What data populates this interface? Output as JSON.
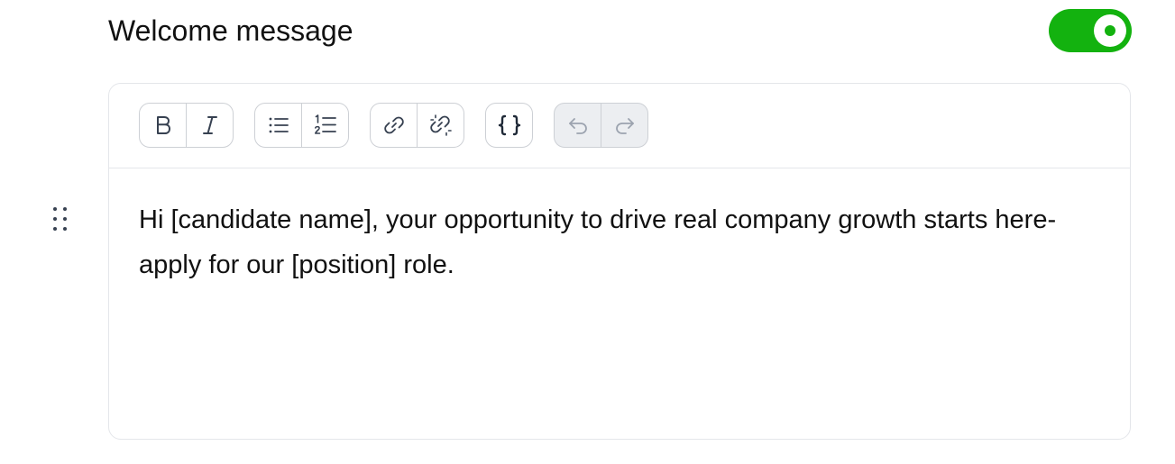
{
  "section": {
    "title": "Welcome message",
    "toggle_on": true
  },
  "toolbar": {
    "groups": [
      {
        "buttons": [
          {
            "name": "bold",
            "icon": "bold-icon"
          },
          {
            "name": "italic",
            "icon": "italic-icon"
          }
        ]
      },
      {
        "buttons": [
          {
            "name": "bullet-list",
            "icon": "bullet-list-icon"
          },
          {
            "name": "numbered-list",
            "icon": "numbered-list-icon"
          }
        ]
      },
      {
        "buttons": [
          {
            "name": "link",
            "icon": "link-icon"
          },
          {
            "name": "unlink",
            "icon": "unlink-icon"
          }
        ]
      },
      {
        "buttons": [
          {
            "name": "variable",
            "icon": "curly-braces-icon"
          }
        ]
      },
      {
        "buttons": [
          {
            "name": "undo",
            "icon": "undo-icon"
          },
          {
            "name": "redo",
            "icon": "redo-icon"
          }
        ],
        "disabled": true
      }
    ]
  },
  "editor": {
    "content": "Hi [candidate name], your opportunity to drive real company growth starts here- apply for our [position] role."
  },
  "colors": {
    "accent": "#13b20f",
    "border": "#e4e6ea",
    "button_border": "#cdd0d5",
    "disabled_bg": "#eceef1",
    "icon": "#4b5563"
  }
}
